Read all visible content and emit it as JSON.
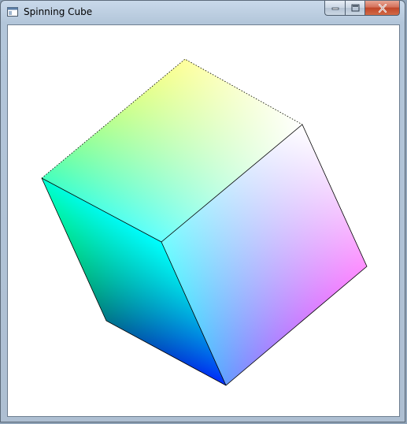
{
  "window": {
    "title": "Spinning Cube",
    "icons": {
      "app": "app-window-icon",
      "minimize": "minimize-icon",
      "maximize": "maximize-icon",
      "close": "close-icon"
    }
  },
  "scene": {
    "object": "rgb-color-cube",
    "background": "#ffffff",
    "edge_color": "#000000",
    "vertex_colors": {
      "top": "#ffff00",
      "left": "#00ff00",
      "back-right": "#ffffff",
      "center": "#00ffff",
      "right": "#ff00ff",
      "bottom-left": "#000000",
      "bottom": "#0000ff"
    }
  }
}
